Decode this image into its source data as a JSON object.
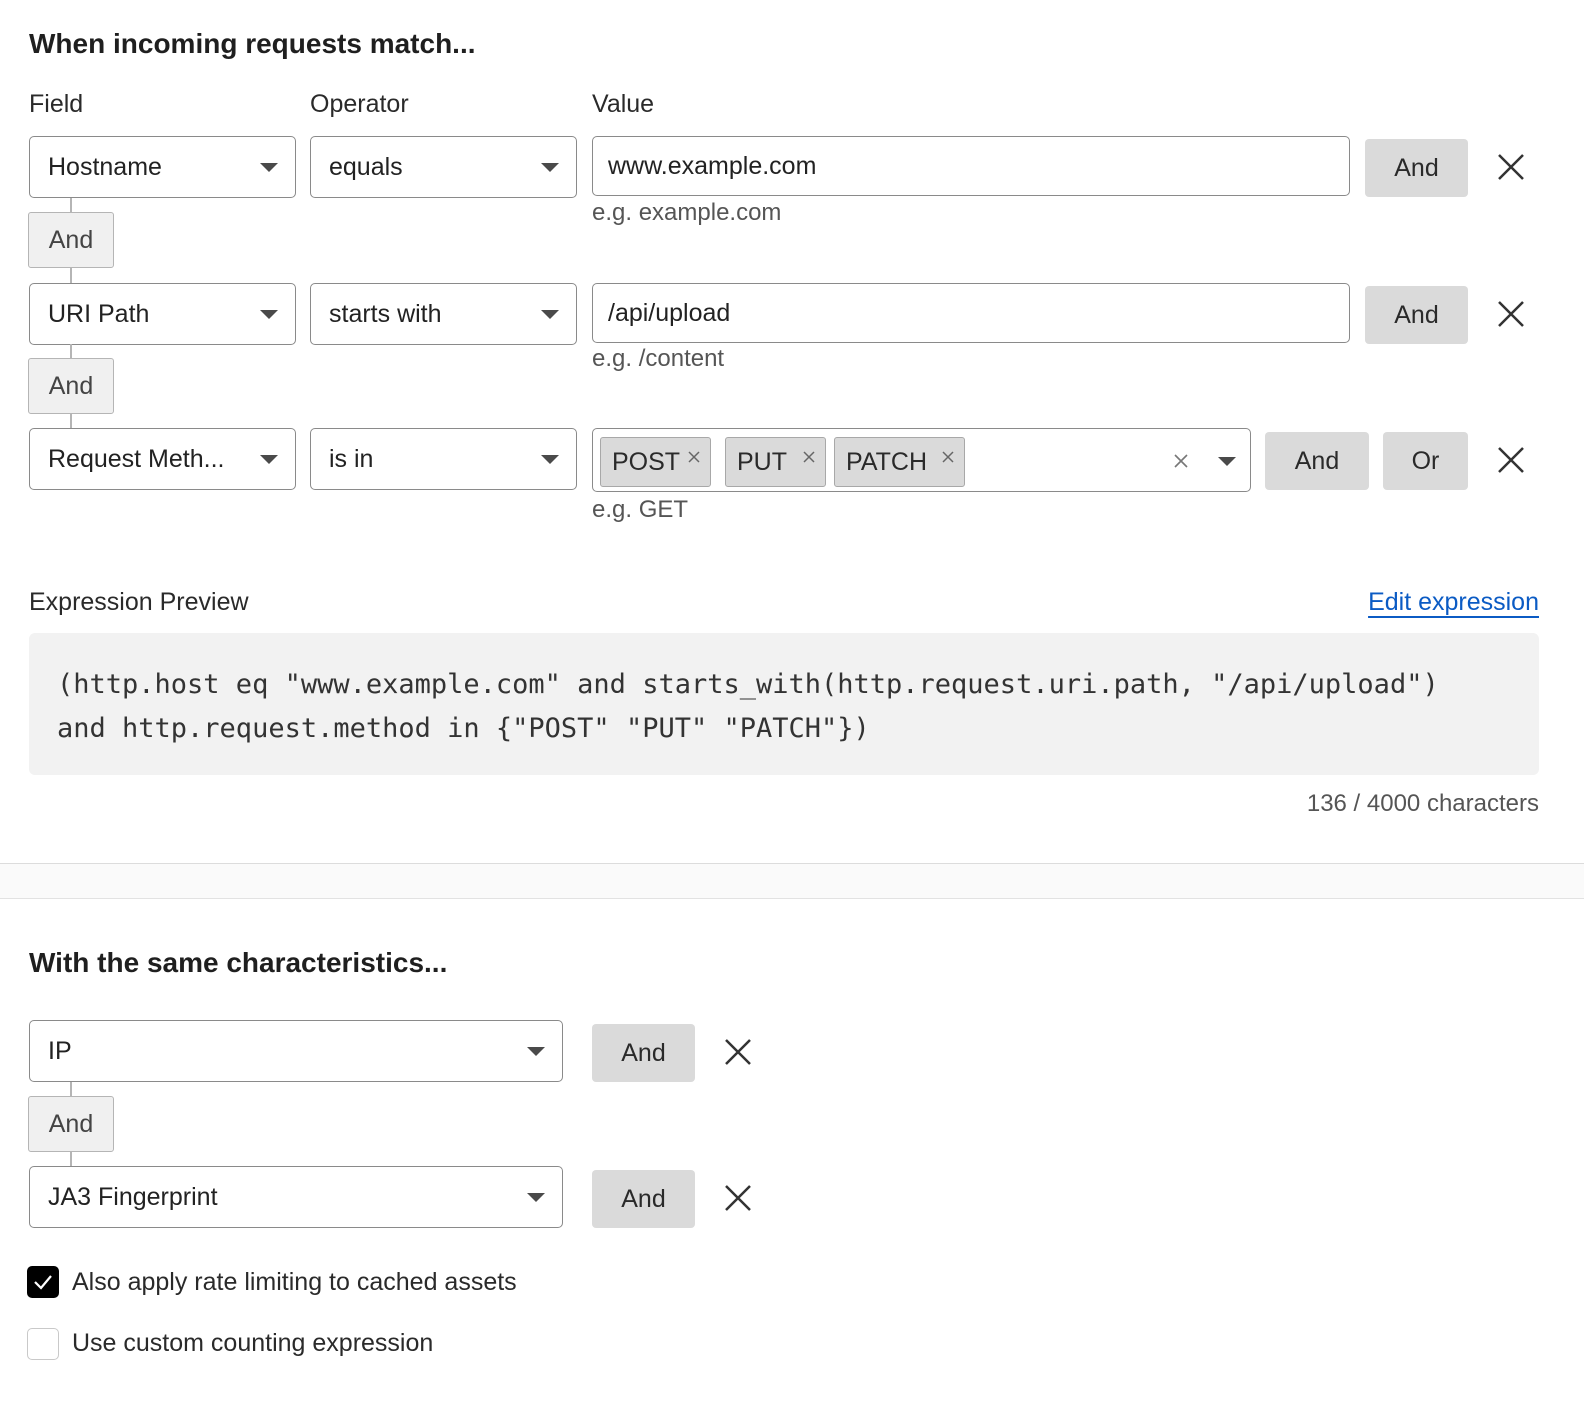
{
  "section1": {
    "heading": "When incoming requests match...",
    "col_field": "Field",
    "col_operator": "Operator",
    "col_value": "Value",
    "rows": [
      {
        "field": "Hostname",
        "operator": "equals",
        "value": "www.example.com",
        "hint": "e.g. example.com",
        "and_label": "And"
      },
      {
        "field": "URI Path",
        "operator": "starts with",
        "value": "/api/upload",
        "hint": "e.g. /content",
        "and_label": "And"
      },
      {
        "field": "Request Meth...",
        "operator": "is in",
        "tags": [
          "POST",
          "PUT",
          "PATCH"
        ],
        "hint": "e.g. GET",
        "and_label": "And",
        "or_label": "Or"
      }
    ],
    "connector_label": "And",
    "preview_label": "Expression Preview",
    "edit_link": "Edit expression",
    "expression": "(http.host eq \"www.example.com\" and starts_with(http.request.uri.path, \"/api/upload\")\nand http.request.method in {\"POST\" \"PUT\" \"PATCH\"})",
    "char_count": "136 / 4000 characters"
  },
  "section2": {
    "heading": "With the same characteristics...",
    "rows": [
      {
        "field": "IP",
        "and_label": "And"
      },
      {
        "field": "JA3 Fingerprint",
        "and_label": "And"
      }
    ],
    "connector_label": "And",
    "checkboxes": [
      {
        "label": "Also apply rate limiting to cached assets",
        "checked": true
      },
      {
        "label": "Use custom counting expression",
        "checked": false
      }
    ]
  },
  "colors": {
    "accent_link": "#0b5bc4",
    "button_bg": "#dadada",
    "checkbox_checked": "#000000"
  },
  "icons": {
    "remove": "close-icon",
    "dropdown": "chevron-down-icon",
    "check": "checkmark-icon"
  }
}
